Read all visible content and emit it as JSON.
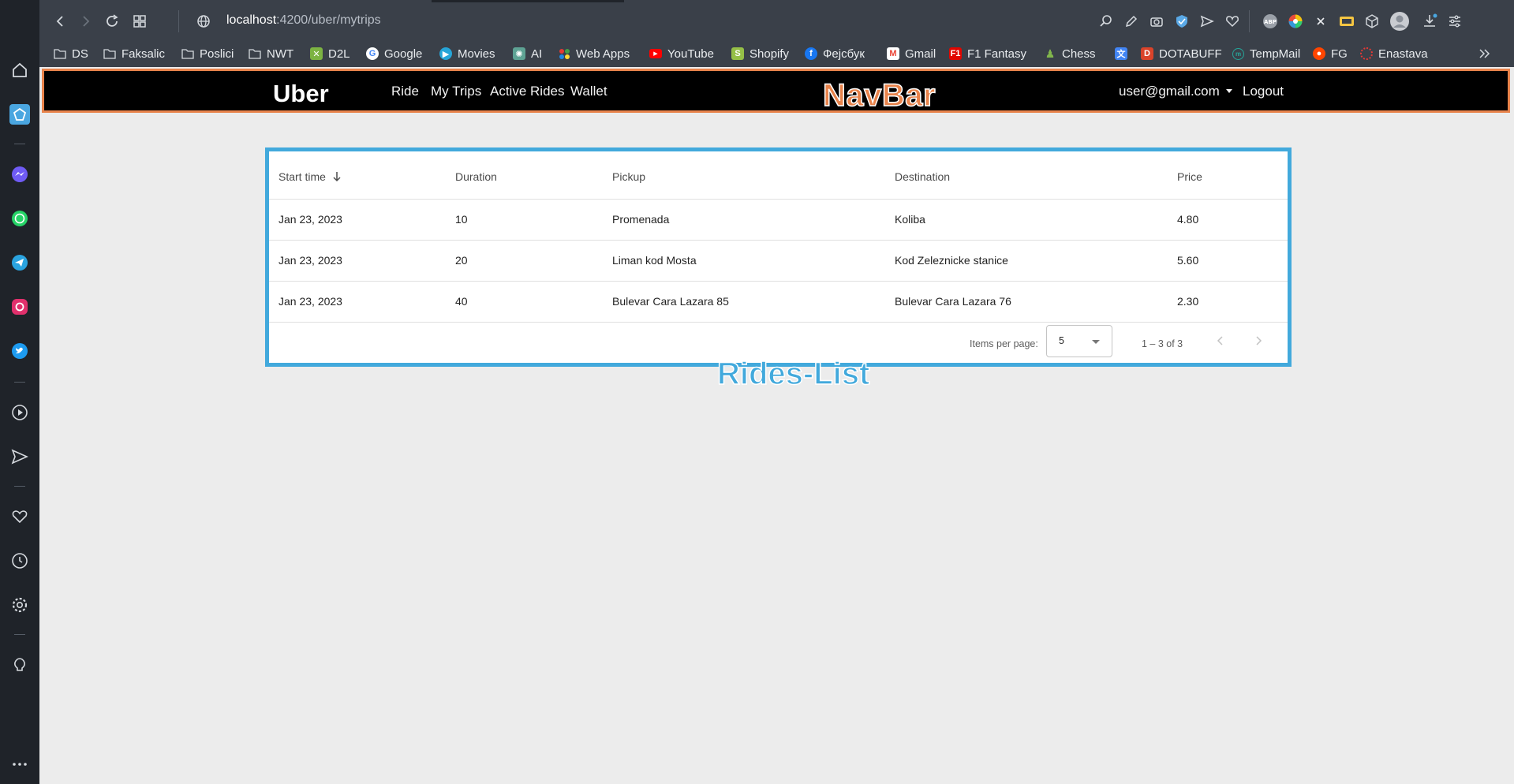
{
  "browser": {
    "url_host": "localhost",
    "url_path": ":4200/uber/mytrips",
    "bookmarks": [
      {
        "label": "DS",
        "icon": "folder-icon"
      },
      {
        "label": "Faksalic",
        "icon": "folder-icon"
      },
      {
        "label": "Poslici",
        "icon": "folder-icon"
      },
      {
        "label": "NWT",
        "icon": "folder-icon"
      },
      {
        "label": "D2L",
        "icon": "d2l-icon"
      },
      {
        "label": "Google",
        "icon": "google-icon"
      },
      {
        "label": "Movies",
        "icon": "play-icon"
      },
      {
        "label": "AI",
        "icon": "ai-icon"
      },
      {
        "label": "Web Apps",
        "icon": "web-apps-icon"
      },
      {
        "label": "YouTube",
        "icon": "youtube-icon"
      },
      {
        "label": "Shopify",
        "icon": "shopify-icon"
      },
      {
        "label": "Фејсбук",
        "icon": "facebook-icon"
      },
      {
        "label": "Gmail",
        "icon": "gmail-icon"
      },
      {
        "label": "F1 Fantasy",
        "icon": "f1-icon"
      },
      {
        "label": "Chess",
        "icon": "chess-icon"
      },
      {
        "label": "",
        "icon": "translate-icon"
      },
      {
        "label": "DOTABUFF",
        "icon": "dotabuff-icon"
      },
      {
        "label": "TempMail",
        "icon": "tempmail-icon"
      },
      {
        "label": "FG",
        "icon": "reddit-icon"
      },
      {
        "label": "Enastava",
        "icon": "enastava-icon"
      }
    ]
  },
  "navbar": {
    "brand": "Uber",
    "links": [
      "Ride",
      "My Trips",
      "Active Rides",
      "Wallet"
    ],
    "user_email": "user@gmail.com",
    "logout": "Logout",
    "annotation": "NavBar",
    "annotation_color": "#e8834b"
  },
  "rides": {
    "annotation": "Rides-List",
    "annotation_color": "#42a9dc",
    "columns": [
      "Start time",
      "Duration",
      "Pickup",
      "Destination",
      "Price"
    ],
    "sort_icon": "arrow-down-icon",
    "rows": [
      [
        "Jan 23, 2023",
        "10",
        "Promenada",
        "Koliba",
        "4.80"
      ],
      [
        "Jan 23, 2023",
        "20",
        "Liman kod Mosta",
        "Kod Zeleznicke stanice",
        "5.60"
      ],
      [
        "Jan 23, 2023",
        "40",
        "Bulevar Cara Lazara 85",
        "Bulevar Cara Lazara 76",
        "2.30"
      ]
    ],
    "paginator": {
      "items_per_page_label": "Items per page:",
      "page_size": "5",
      "range_label": "1 – 3 of 3"
    }
  }
}
